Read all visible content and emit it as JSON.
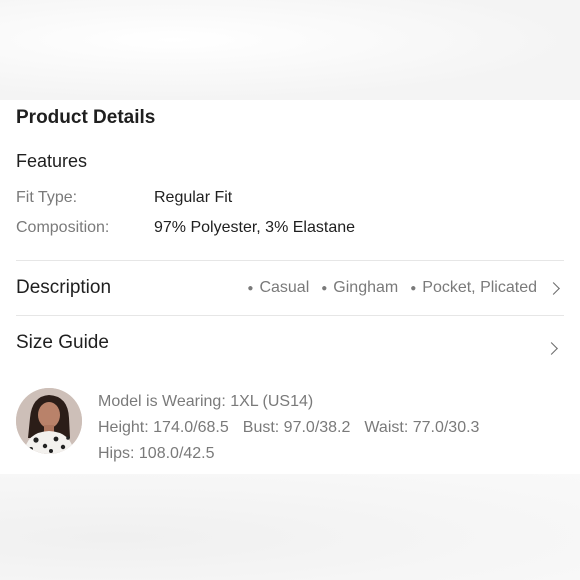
{
  "product_details": {
    "title": "Product Details",
    "features": {
      "heading": "Features",
      "rows": [
        {
          "label": "Fit Type:",
          "value": "Regular Fit"
        },
        {
          "label": "Composition:",
          "value": "97% Polyester, 3% Elastane"
        }
      ]
    },
    "description": {
      "label": "Description",
      "tags": [
        "Casual",
        "Gingham",
        "Pocket, Plicated"
      ]
    },
    "size_guide": {
      "label": "Size Guide"
    },
    "model": {
      "wearing": "Model is Wearing: 1XL (US14)",
      "height": "Height: 174.0/68.5",
      "bust": "Bust: 97.0/38.2",
      "waist": "Waist: 77.0/30.3",
      "hips": "Hips: 108.0/42.5"
    }
  },
  "colors": {
    "primary_text": "#1f1f1f",
    "secondary_text": "#7a7a7a",
    "divider": "#e6e6e6"
  }
}
